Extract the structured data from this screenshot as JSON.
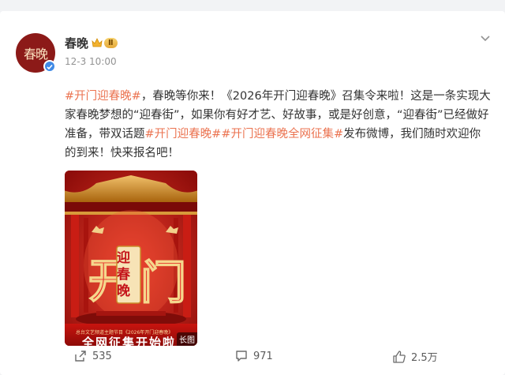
{
  "post": {
    "author": {
      "name": "春晚",
      "avatar_text": "春晚",
      "level_badge": "Ⅱ",
      "verified": true
    },
    "time": "12-3 10:00",
    "text_segments": [
      {
        "text": "#开门迎春晚#",
        "type": "tag"
      },
      {
        "text": "，春晚等你来！《2026年开门迎春晚》召集令来啦！这是一条实现大家春晚梦想的“迎春街”，如果你有好才艺、好故事，或是好创意，“迎春街”已经做好准备，带双话题",
        "type": "text"
      },
      {
        "text": "#开门迎春晚#",
        "type": "tag"
      },
      {
        "text": "#开门迎春晚全网征集#",
        "type": "tag"
      },
      {
        "text": "发布微博，我们随时欢迎你的到来！快来报名吧！",
        "type": "text"
      }
    ],
    "image": {
      "title_chars": "迎春晚",
      "footer_small": "总台文艺频道主题节目《2026年开门迎春晚》",
      "footer_big": "全网征集开始啦",
      "long_image_label": "长图"
    },
    "actions": {
      "share_count": "535",
      "comment_count": "971",
      "like_count": "2.5万"
    }
  },
  "colors": {
    "tag": "#eb7350",
    "verified": "#3f8ae6",
    "poster_red": "#b0120e"
  },
  "icons": [
    "crown-icon",
    "verified-icon",
    "chevron-down-icon",
    "share-icon",
    "comment-icon",
    "like-icon"
  ]
}
